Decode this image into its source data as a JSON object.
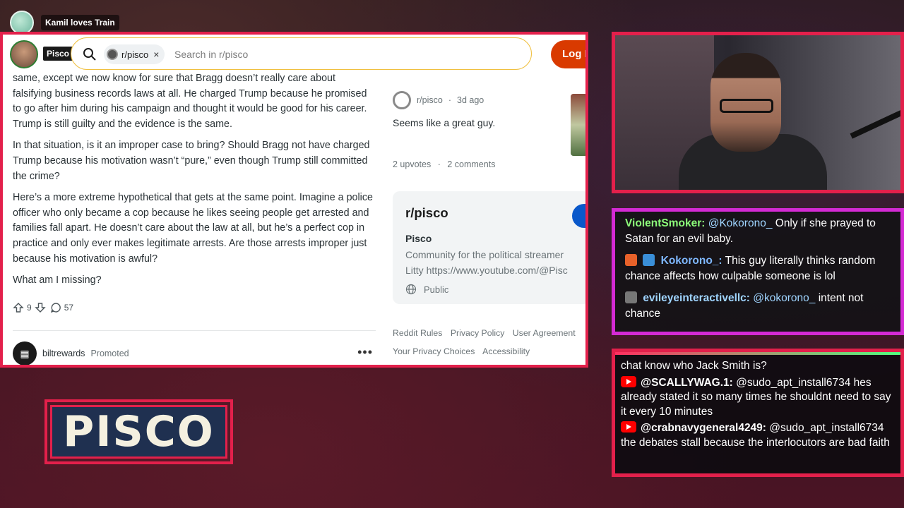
{
  "notice": {
    "text": "Kamil loves Train"
  },
  "browser": {
    "channel_tag": "Pisco",
    "search": {
      "chip": "r/pisco",
      "chip_close": "×",
      "placeholder": "Search in r/pisco"
    },
    "login_label": "Log I",
    "post": {
      "paragraphs": [
        "same, except we now know for sure that Bragg doesn’t really care about falsifying business records laws at all. He charged Trump because he promised to go after him during his campaign and thought it would be good for his career. Trump is still guilty and the evidence is the same.",
        "In that situation, is it an improper case to bring? Should Bragg not have charged Trump because his motivation wasn’t “pure,” even though Trump still committed the crime?",
        "Here’s a more extreme hypothetical that gets at the same point. Imagine a police officer who only became a cop because he likes seeing people get arrested and families fall apart. He doesn’t care about the law at all, but he’s a perfect cop in practice and only ever makes legitimate arrests. Are those arrests improper just because his motivation is awful?",
        "What am I missing?"
      ],
      "upvotes": "9",
      "comments": "57"
    },
    "promo": {
      "name": "biltrewards",
      "tag": "Promoted",
      "more": "•••"
    },
    "related": {
      "subreddit": "r/pisco",
      "time": "3d ago",
      "text": "Seems like a great guy.",
      "upvotes": "2 upvotes",
      "dot": "·",
      "comments": "2 comments"
    },
    "sub_card": {
      "title": "r/pisco",
      "name": "Pisco",
      "description_1": "Community for the political streamer",
      "description_2": "Litty https://www.youtube.com/@Pisc",
      "visibility": "Public"
    },
    "footer_links": [
      "Reddit Rules",
      "Privacy Policy",
      "User Agreement",
      "Your Privacy Choices",
      "Accessibility"
    ]
  },
  "twitch_chat": [
    {
      "user": "ViolentSmoker:",
      "user_color": "#8dff7a",
      "mention": "@Kokorono_",
      "text": " Only if she prayed to Satan for an evil baby."
    },
    {
      "user": "Kokorono_:",
      "user_color": "#7fb8ff",
      "mention": "",
      "text": " This guy literally thinks random chance affects how culpable someone is lol"
    },
    {
      "user": "evileyeinteractivellc:",
      "user_color": "#9fd4ff",
      "mention": "@kokorono_",
      "text": " intent not chance"
    }
  ],
  "youtube_chat": {
    "first_line": "chat know who Jack Smith is?",
    "messages": [
      {
        "user": "@SCALLYWAG.1:",
        "text": " @sudo_apt_install6734 hes already stated it so many times he shouldnt need to say it every 10 minutes"
      },
      {
        "user": "@crabnavygeneral4249:",
        "text": " @sudo_apt_install6734 the debates stall because the interlocutors are bad faith"
      }
    ]
  },
  "logo": {
    "text": "PISCO"
  },
  "colors": {
    "frame_red": "#e3204b",
    "frame_magenta": "#d42ad4",
    "reddit_orange": "#d93a00"
  }
}
